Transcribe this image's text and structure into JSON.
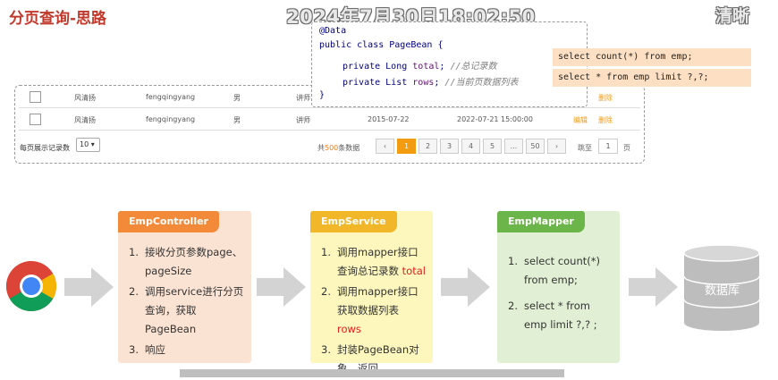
{
  "header": {
    "title": "分页查询-思路",
    "timestamp": "2024年7月30日18:02:50",
    "quality": "清晰"
  },
  "table": {
    "rows": [
      {
        "name": "风清扬",
        "username": "fengqingyang",
        "gender": "男",
        "job": "讲师",
        "date": "",
        "time": "",
        "edit": "",
        "delete": "删除"
      },
      {
        "name": "风清扬",
        "username": "fengqingyang",
        "gender": "男",
        "job": "讲师",
        "date": "2015-07-22",
        "time": "2022-07-21 15:00:00",
        "edit": "编辑",
        "delete": "删除"
      }
    ],
    "page_size_label": "每页展示记录数",
    "page_size_value": "10 ▾",
    "total_prefix": "共",
    "total_count": "500",
    "total_suffix": "条数据",
    "pages": [
      "‹",
      "1",
      "2",
      "3",
      "4",
      "5",
      "...",
      "50",
      "›"
    ],
    "jump_label": "跳至",
    "jump_value": "1",
    "jump_unit": "页"
  },
  "code": {
    "annotation": "@Data",
    "class_decl": "public class PageBean {",
    "field1_mod": "private Long ",
    "field1_name": "total",
    "field1_comment": "//总记录数",
    "field2_mod": "private List ",
    "field2_name": "rows",
    "field2_comment": "//当前页数据列表",
    "close": "}"
  },
  "sql": {
    "count": "select count(*) from emp;",
    "list": "select * from emp limit ?,?;"
  },
  "flow": {
    "controller": {
      "title": "EmpController",
      "items": [
        "接收分页参数page、pageSize",
        "调用service进行分页查询，获取PageBean",
        "响应"
      ]
    },
    "service": {
      "title": "EmpService",
      "item1": "调用mapper接口查询总记录数",
      "item1_hl": "total",
      "item2": "调用mapper接口获取数据列表",
      "item2_hl": "rows",
      "item3": "封装PageBean对象，返回"
    },
    "mapper": {
      "title": "EmpMapper",
      "items": [
        "select count(*) from emp;",
        "select * from emp limit ?,? ;"
      ]
    },
    "database": "数据库"
  },
  "colors": {
    "controller_bg": "#fbe3d3",
    "controller_head": "#f28a3a",
    "service_bg": "#fdf7be",
    "service_head": "#f2b729",
    "mapper_bg": "#e1f0d4",
    "mapper_head": "#6cb54a"
  },
  "icons": {
    "browser": "chrome-icon",
    "database": "database-icon",
    "arrow": "arrow-right-icon"
  }
}
